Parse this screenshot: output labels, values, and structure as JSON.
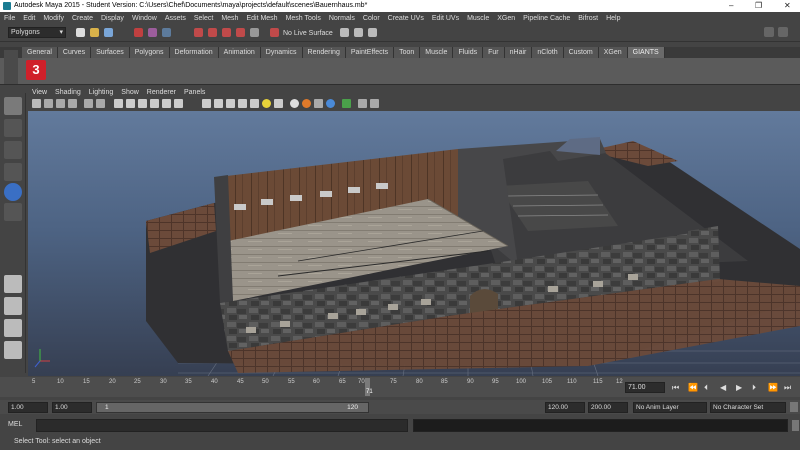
{
  "window": {
    "title": "Autodesk Maya 2015 - Student Version: C:\\Users\\Chef\\Documents\\maya\\projects\\default\\scenes\\Bauernhaus.mb*"
  },
  "menu": [
    "File",
    "Edit",
    "Modify",
    "Create",
    "Display",
    "Window",
    "Assets",
    "Select",
    "Mesh",
    "Edit Mesh",
    "Mesh Tools",
    "Normals",
    "Color",
    "Create UVs",
    "Edit UVs",
    "Muscle",
    "XGen",
    "Pipeline Cache",
    "Bifrost",
    "Help"
  ],
  "status_line": {
    "mode": "Polygons",
    "live_surface": "No Live Surface"
  },
  "shelf": {
    "tabs": [
      "General",
      "Curves",
      "Surfaces",
      "Polygons",
      "Deformation",
      "Animation",
      "Dynamics",
      "Rendering",
      "PaintEffects",
      "Toon",
      "Muscle",
      "Fluids",
      "Fur",
      "nHair",
      "nCloth",
      "Custom",
      "XGen",
      "GIANTS"
    ],
    "active_tab": "GIANTS",
    "icon_label": "3"
  },
  "panel_menu": [
    "View",
    "Shading",
    "Lighting",
    "Show",
    "Renderer",
    "Panels"
  ],
  "time_slider": {
    "ticks": [
      "5",
      "10",
      "15",
      "20",
      "25",
      "30",
      "35",
      "40",
      "45",
      "50",
      "55",
      "60",
      "65",
      "70",
      "75",
      "80",
      "85",
      "90",
      "95",
      "100",
      "105",
      "110",
      "115",
      "12"
    ],
    "current_frame_marker": "71",
    "current_frame": "71.00"
  },
  "range": {
    "start": "1.00",
    "playback_start": "1.00",
    "slider_min": "1",
    "slider_max": "120",
    "playback_end": "120.00",
    "end": "200.00",
    "anim_layer": "No Anim Layer",
    "character_set": "No Character Set"
  },
  "command_line": {
    "label": "MEL"
  },
  "help_line": "Select Tool: select an object",
  "colors": {
    "accent": "#d0202a",
    "viewport_top": "#627a9c",
    "viewport_bottom": "#363f52"
  }
}
